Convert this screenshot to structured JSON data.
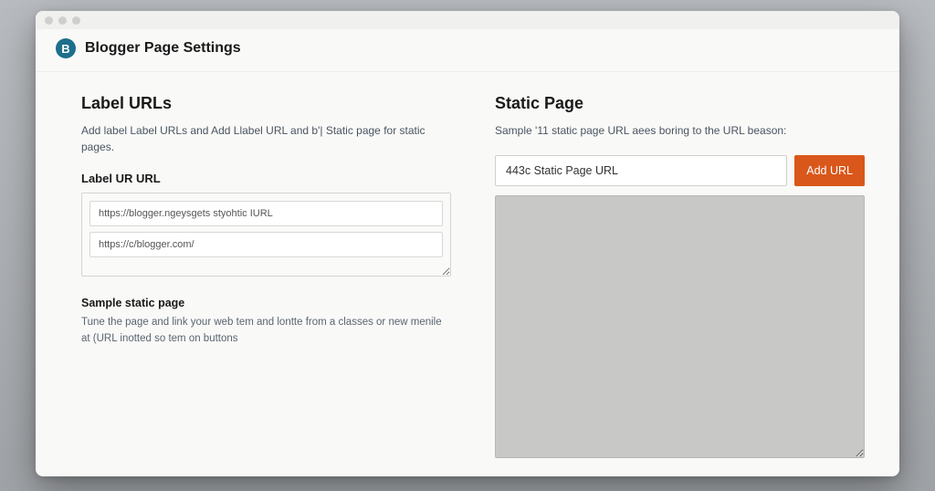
{
  "header": {
    "logo_letter": "B",
    "title": "Blogger Page Settings"
  },
  "left": {
    "section_title": "Label URLs",
    "section_desc": "Add label Label URLs and Add Llabel URL and b'| Static page for static pages.",
    "field_label": "Label UR URL",
    "urls": [
      "https://blogger.ngeysgets styohtic IURL",
      "https://c/blogger.com/"
    ],
    "sample_title": "Sample static page",
    "sample_desc": "Tune the page and link your web tem and lontte from a classes or new menile at (URL inotted so tem on buttons"
  },
  "right": {
    "section_title": "Static Page",
    "section_desc": "Sample '11 static page URL aees boring to the URL beason:",
    "input_value": "443c Static Page URL",
    "add_label": "Add URL"
  }
}
